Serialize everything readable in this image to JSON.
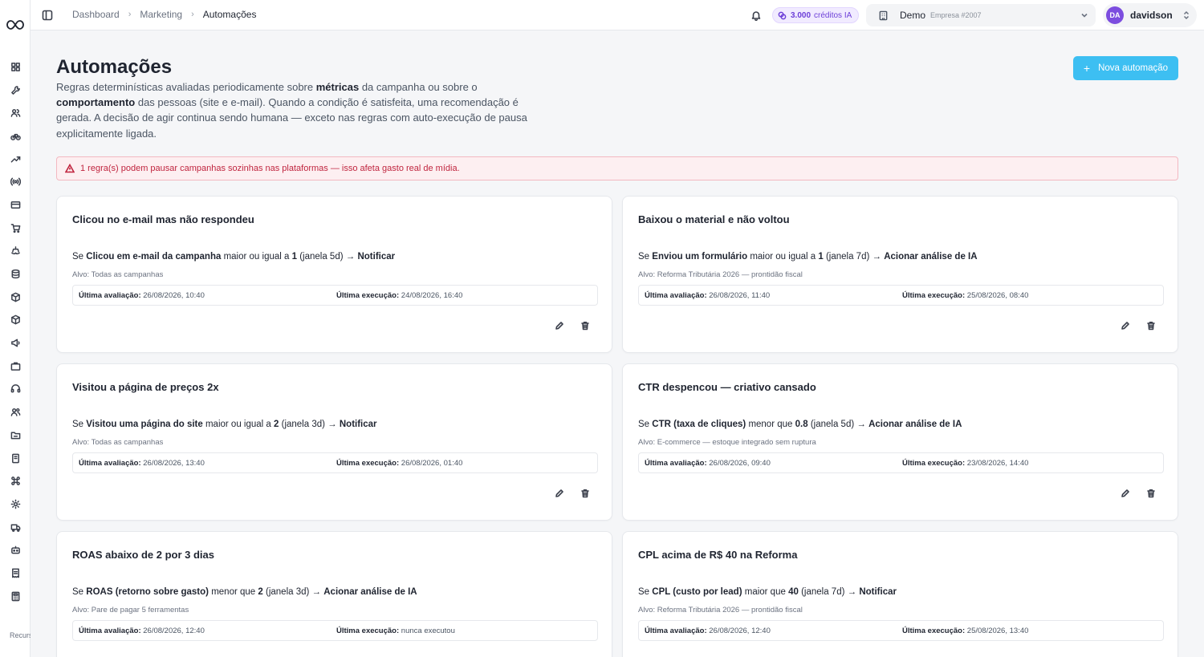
{
  "breadcrumb": [
    "Dashboard",
    "Marketing",
    "Automações"
  ],
  "credits": {
    "amount": "3.000",
    "label": "créditos IA"
  },
  "company": {
    "name": "Demo",
    "id": "Empresa #2007"
  },
  "user": {
    "initials": "DA",
    "name": "davidson"
  },
  "sidebar": {
    "icons": [
      "dashboard-icon",
      "wrench-icon",
      "users-icon",
      "bike-icon",
      "trending-icon",
      "broadcast-icon",
      "card-icon",
      "cart-icon",
      "ship-icon",
      "database-icon",
      "package-icon",
      "box-icon",
      "megaphone-icon",
      "briefcase-icon",
      "headset-icon",
      "team-icon",
      "folder-icon",
      "building-icon",
      "command-icon",
      "settings-icon",
      "truck-icon",
      "bot-icon",
      "receipt-icon",
      "calculator-icon"
    ],
    "footer": "Recursos avançados"
  },
  "page": {
    "title": "Automações",
    "desc_parts": [
      "Regras determinísticas avaliadas periodicamente sobre ",
      "métricas",
      " da campanha ou sobre o ",
      "comportamento",
      " das pessoas (site e e-mail). Quando a condição é satisfeita, uma recomendação é gerada. A decisão de agir continua sendo humana — exceto nas regras com auto-execução de pausa explicitamente ligada."
    ],
    "new_button": "Nova automação",
    "alert": "1 regra(s) podem pausar campanhas sozinhas nas plataformas — isso afeta gasto real de mídia."
  },
  "labels": {
    "if": "Se",
    "last_eval": "Última avaliação:",
    "last_exec": "Última execução:"
  },
  "cards": [
    {
      "title": "Clicou no e-mail mas não respondeu",
      "metric": "Clicou em e-mail da campanha",
      "op": "maior ou igual a",
      "value": "1",
      "window": "(janela 5d) →",
      "action": "Notificar",
      "target": "Alvo: Todas as campanhas",
      "last_eval": "26/08/2026, 10:40",
      "last_exec": "24/08/2026, 16:40"
    },
    {
      "title": "Baixou o material e não voltou",
      "metric": "Enviou um formulário",
      "op": "maior ou igual a",
      "value": "1",
      "window": "(janela 7d) →",
      "action": "Acionar análise de IA",
      "target": "Alvo: Reforma Tributária 2026 — prontidão fiscal",
      "last_eval": "26/08/2026, 11:40",
      "last_exec": "25/08/2026, 08:40"
    },
    {
      "title": "Visitou a página de preços 2x",
      "metric": "Visitou uma página do site",
      "op": "maior ou igual a",
      "value": "2",
      "window": "(janela 3d) →",
      "action": "Notificar",
      "target": "Alvo: Todas as campanhas",
      "last_eval": "26/08/2026, 13:40",
      "last_exec": "26/08/2026, 01:40"
    },
    {
      "title": "CTR despencou — criativo cansado",
      "metric": "CTR (taxa de cliques)",
      "op": "menor que",
      "value": "0.8",
      "window": "(janela 5d) →",
      "action": "Acionar análise de IA",
      "target": "Alvo: E-commerce — estoque integrado sem ruptura",
      "last_eval": "26/08/2026, 09:40",
      "last_exec": "23/08/2026, 14:40"
    },
    {
      "title": "ROAS abaixo de 2 por 3 dias",
      "metric": "ROAS (retorno sobre gasto)",
      "op": "menor que",
      "value": "2",
      "window": "(janela 3d) →",
      "action": "Acionar análise de IA",
      "target": "Alvo: Pare de pagar 5 ferramentas",
      "last_eval": "26/08/2026, 12:40",
      "last_exec": "nunca executou"
    },
    {
      "title": "CPL acima de R$ 40 na Reforma",
      "metric": "CPL (custo por lead)",
      "op": "maior que",
      "value": "40",
      "window": "(janela 7d) →",
      "action": "Notificar",
      "target": "Alvo: Reforma Tributária 2026 — prontidão fiscal",
      "last_eval": "26/08/2026, 12:40",
      "last_exec": "25/08/2026, 13:40"
    }
  ]
}
